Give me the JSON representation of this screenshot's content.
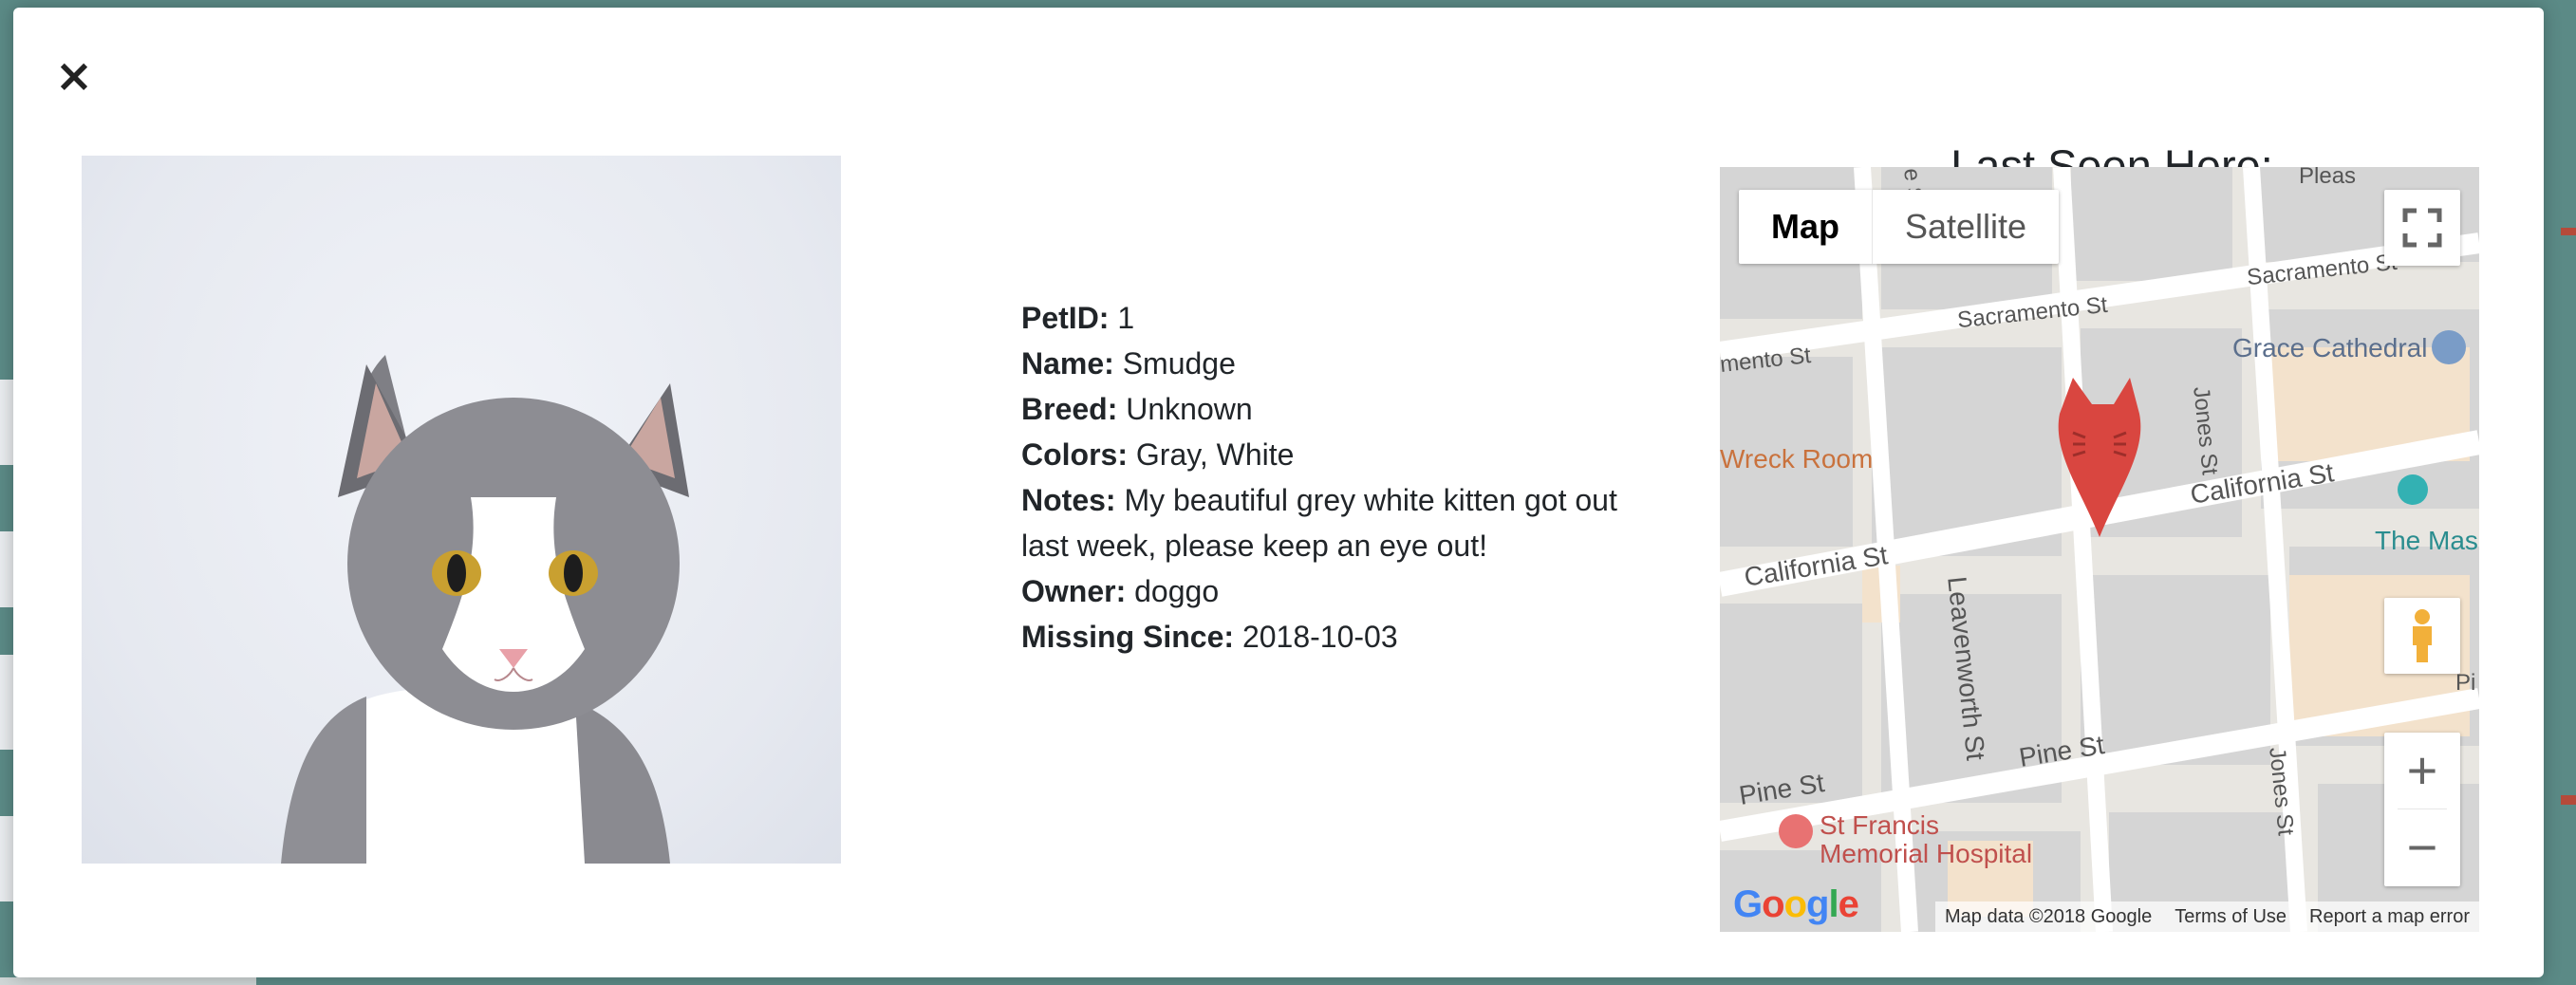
{
  "modal": {
    "close_label": "×"
  },
  "pet": {
    "fields": [
      {
        "label": "PetID:",
        "value": "1"
      },
      {
        "label": "Name:",
        "value": "Smudge"
      },
      {
        "label": "Breed:",
        "value": "Unknown"
      },
      {
        "label": "Colors:",
        "value": "Gray, White"
      },
      {
        "label": "Notes:",
        "value": "My beautiful grey white kitten got out last week, please keep an eye out!"
      },
      {
        "label": "Owner:",
        "value": "doggo"
      },
      {
        "label": "Missing Since:",
        "value": "2018-10-03"
      }
    ],
    "photo_icon": "cat-photo"
  },
  "map": {
    "title": "Last Seen Here:",
    "type_buttons": {
      "map": "Map",
      "satellite": "Satellite"
    },
    "zoom_in": "+",
    "zoom_out": "−",
    "labels": {
      "sacramento1": "Sacramento St",
      "sacramento2": "Sacramento St",
      "sacramento3": "mento St",
      "grace": "Grace Cathedral",
      "wreck": "Wreck Room",
      "california1": "California St",
      "california2": "California St",
      "mason": "The Mas",
      "jones1": "Jones St",
      "jones2": "Jones St",
      "leavenworth": "Leavenworth St",
      "pine1": "Pine St",
      "pine2": "Pine St",
      "stfrancis1": "St Francis",
      "stfrancis2": "Memorial Hospital",
      "pleas": "Pleas",
      "hyde": "e St",
      "pi": "Pi"
    },
    "google_logo": "Google",
    "attribution": [
      "Map data ©2018 Google",
      "Terms of Use",
      "Report a map error"
    ],
    "marker_icon": "cat-marker-icon",
    "colors": {
      "marker": "#d94640",
      "road": "#ffffff",
      "block": "#d6d6d6",
      "park": "#f5e3cf"
    }
  }
}
